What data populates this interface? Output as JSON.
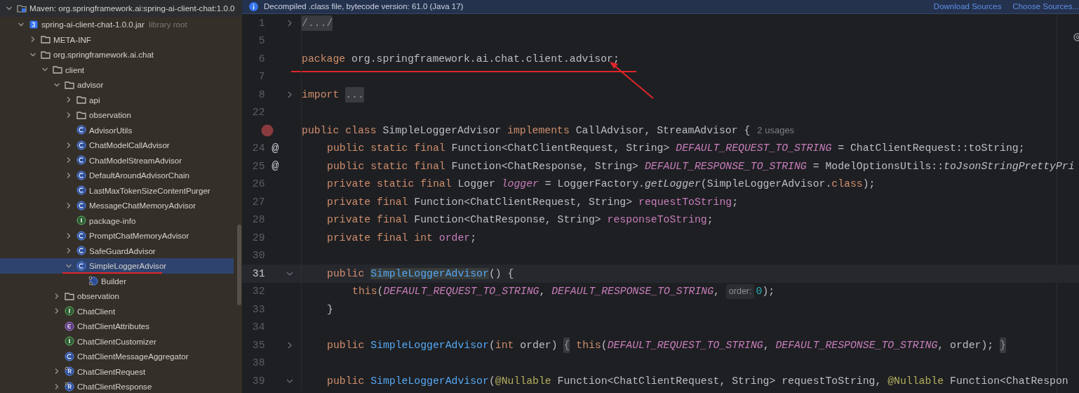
{
  "info_bar": {
    "message": "Decompiled .class file, bytecode version: 61.0 (Java 17)",
    "links": [
      "Download Sources",
      "Choose Sources..."
    ]
  },
  "project_tree": {
    "items": [
      {
        "label": "Maven: org.springframework.ai:spring-ai-client-chat:1.0.0",
        "kind": "library",
        "expanded": true,
        "selected": false,
        "children": [
          {
            "label": "spring-ai-client-chat-1.0.0.jar",
            "hint": "library root",
            "kind": "jar",
            "expanded": true,
            "selected": false,
            "children": [
              {
                "label": "META-INF",
                "kind": "folder",
                "expanded": false,
                "selected": false
              },
              {
                "label": "org.springframework.ai.chat",
                "kind": "folder",
                "expanded": true,
                "selected": false,
                "children": [
                  {
                    "label": "client",
                    "kind": "folder",
                    "expanded": true,
                    "selected": false,
                    "children": [
                      {
                        "label": "advisor",
                        "kind": "folder",
                        "expanded": true,
                        "selected": false,
                        "children": [
                          {
                            "label": "api",
                            "kind": "folder",
                            "expanded": false,
                            "selected": false
                          },
                          {
                            "label": "observation",
                            "kind": "folder",
                            "expanded": false,
                            "selected": false
                          },
                          {
                            "label": "AdvisorUtils",
                            "kind": "class",
                            "selected": false
                          },
                          {
                            "label": "ChatModelCallAdvisor",
                            "kind": "class",
                            "expanded": false,
                            "selected": false
                          },
                          {
                            "label": "ChatModelStreamAdvisor",
                            "kind": "class",
                            "expanded": false,
                            "selected": false
                          },
                          {
                            "label": "DefaultAroundAdvisorChain",
                            "kind": "class",
                            "expanded": false,
                            "selected": false
                          },
                          {
                            "label": "LastMaxTokenSizeContentPurger",
                            "kind": "class",
                            "selected": false
                          },
                          {
                            "label": "MessageChatMemoryAdvisor",
                            "kind": "class",
                            "expanded": false,
                            "selected": false
                          },
                          {
                            "label": "package-info",
                            "kind": "interface",
                            "selected": false
                          },
                          {
                            "label": "PromptChatMemoryAdvisor",
                            "kind": "class",
                            "expanded": false,
                            "selected": false
                          },
                          {
                            "label": "SafeGuardAdvisor",
                            "kind": "class",
                            "expanded": false,
                            "selected": false
                          },
                          {
                            "label": "SimpleLoggerAdvisor",
                            "kind": "class",
                            "expanded": true,
                            "selected": true,
                            "underlined": true,
                            "children": [
                              {
                                "label": "Builder",
                                "kind": "builder",
                                "selected": false
                              }
                            ]
                          }
                        ]
                      },
                      {
                        "label": "observation",
                        "kind": "folder",
                        "expanded": false,
                        "selected": false
                      },
                      {
                        "label": "ChatClient",
                        "kind": "interface",
                        "expanded": false,
                        "selected": false
                      },
                      {
                        "label": "ChatClientAttributes",
                        "kind": "enum",
                        "selected": false
                      },
                      {
                        "label": "ChatClientCustomizer",
                        "kind": "interface",
                        "selected": false
                      },
                      {
                        "label": "ChatClientMessageAggregator",
                        "kind": "class",
                        "selected": false
                      },
                      {
                        "label": "ChatClientRequest",
                        "kind": "record",
                        "expanded": false,
                        "selected": false
                      },
                      {
                        "label": "ChatClientResponse",
                        "kind": "record",
                        "expanded": false,
                        "selected": false
                      }
                    ]
                  }
                ]
              }
            ]
          }
        ]
      }
    ]
  },
  "editor": {
    "lines": [
      {
        "number": "1",
        "fold_expanded": false,
        "tokens": [
          {
            "kind": "folded",
            "text": "/.../"
          }
        ]
      },
      {
        "number": "5"
      },
      {
        "number": "6",
        "underlined": true,
        "arrow": true,
        "tokens": [
          {
            "kind": "kw",
            "text": "package "
          },
          {
            "kind": "plain",
            "text": "org.springframework.ai.chat.client.advisor;"
          }
        ]
      },
      {
        "number": "7"
      },
      {
        "number": "8",
        "fold_expanded": false,
        "tokens": [
          {
            "kind": "kw",
            "text": "import "
          },
          {
            "kind": "folded",
            "text": "..."
          }
        ]
      },
      {
        "number": "22"
      },
      {
        "breakpoint": true,
        "tokens": [
          {
            "kind": "kw",
            "text": "public class "
          },
          {
            "kind": "plain",
            "text": "SimpleLoggerAdvisor "
          },
          {
            "kind": "kw",
            "text": "implements "
          },
          {
            "kind": "plain",
            "text": "CallAdvisor, StreamAdvisor {"
          },
          {
            "kind": "usages",
            "text": "2 usages"
          }
        ],
        "children": [
          {
            "number": "24",
            "marker": "@",
            "tokens": [
              {
                "kind": "kw",
                "text": "public static final "
              },
              {
                "kind": "plain",
                "text": "Function<ChatClientRequest, String> "
              },
              {
                "kind": "const",
                "text": "DEFAULT_REQUEST_TO_STRING"
              },
              {
                "kind": "plain",
                "text": " = ChatClientRequest::toString;"
              }
            ]
          },
          {
            "number": "25",
            "marker": "@",
            "tokens": [
              {
                "kind": "kw",
                "text": "public static final "
              },
              {
                "kind": "plain",
                "text": "Function<ChatResponse, String> "
              },
              {
                "kind": "const",
                "text": "DEFAULT_RESPONSE_TO_STRING"
              },
              {
                "kind": "plain",
                "text": " = ModelOptionsUtils::"
              },
              {
                "kind": "static",
                "text": "toJsonStringPrettyPri"
              }
            ]
          },
          {
            "number": "26",
            "tokens": [
              {
                "kind": "kw",
                "text": "private static final "
              },
              {
                "kind": "plain",
                "text": "Logger "
              },
              {
                "kind": "const",
                "text": "logger"
              },
              {
                "kind": "plain",
                "text": " = LoggerFactory."
              },
              {
                "kind": "static",
                "text": "getLogger"
              },
              {
                "kind": "plain",
                "text": "(SimpleLoggerAdvisor."
              },
              {
                "kind": "kw",
                "text": "class"
              },
              {
                "kind": "plain",
                "text": ");"
              }
            ]
          },
          {
            "number": "27",
            "tokens": [
              {
                "kind": "kw",
                "text": "private final "
              },
              {
                "kind": "plain",
                "text": "Function<ChatClientRequest, String> "
              },
              {
                "kind": "field",
                "text": "requestToString"
              },
              {
                "kind": "plain",
                "text": ";"
              }
            ]
          },
          {
            "number": "28",
            "tokens": [
              {
                "kind": "kw",
                "text": "private final "
              },
              {
                "kind": "plain",
                "text": "Function<ChatResponse, String> "
              },
              {
                "kind": "field",
                "text": "responseToString"
              },
              {
                "kind": "plain",
                "text": ";"
              }
            ]
          },
          {
            "number": "29",
            "tokens": [
              {
                "kind": "kw",
                "text": "private final int "
              },
              {
                "kind": "field",
                "text": "order"
              },
              {
                "kind": "plain",
                "text": ";"
              }
            ]
          },
          {
            "number": "30"
          },
          {
            "number": "31",
            "current": true,
            "fold_expanded": true,
            "tokens": [
              {
                "kind": "kw",
                "text": "public "
              },
              {
                "kind": "decl-mark",
                "text": "SimpleLoggerAdvisor"
              },
              {
                "kind": "plain",
                "text": "() {"
              }
            ],
            "children": [
              {
                "number": "32",
                "tokens": [
                  {
                    "kind": "kw",
                    "text": "this"
                  },
                  {
                    "kind": "plain",
                    "text": "("
                  },
                  {
                    "kind": "const",
                    "text": "DEFAULT_REQUEST_TO_STRING"
                  },
                  {
                    "kind": "plain",
                    "text": ", "
                  },
                  {
                    "kind": "const",
                    "text": "DEFAULT_RESPONSE_TO_STRING"
                  },
                  {
                    "kind": "plain",
                    "text": ", "
                  },
                  {
                    "kind": "hint",
                    "text": "order:"
                  },
                  {
                    "kind": "num",
                    "text": "0"
                  },
                  {
                    "kind": "plain",
                    "text": ");"
                  }
                ]
              }
            ]
          },
          {
            "number": "33",
            "tokens": [
              {
                "kind": "plain",
                "text": "}"
              }
            ]
          },
          {
            "number": "34"
          },
          {
            "number": "35",
            "fold_expanded": false,
            "tokens": [
              {
                "kind": "kw",
                "text": "public "
              },
              {
                "kind": "decl",
                "text": "SimpleLoggerAdvisor"
              },
              {
                "kind": "plain",
                "text": "("
              },
              {
                "kind": "kw",
                "text": "int "
              },
              {
                "kind": "plain",
                "text": "order) "
              },
              {
                "kind": "folded",
                "text": "{"
              },
              {
                "kind": "kw",
                "text": " this"
              },
              {
                "kind": "plain",
                "text": "("
              },
              {
                "kind": "const",
                "text": "DEFAULT_REQUEST_TO_STRING"
              },
              {
                "kind": "plain",
                "text": ", "
              },
              {
                "kind": "const",
                "text": "DEFAULT_RESPONSE_TO_STRING"
              },
              {
                "kind": "plain",
                "text": ", order); "
              },
              {
                "kind": "folded",
                "text": "}"
              }
            ]
          },
          {
            "number": "38"
          },
          {
            "number": "39",
            "fold_expanded": true,
            "tokens": [
              {
                "kind": "kw",
                "text": "public "
              },
              {
                "kind": "decl",
                "text": "SimpleLoggerAdvisor"
              },
              {
                "kind": "plain",
                "text": "("
              },
              {
                "kind": "annot",
                "text": "@Nullable "
              },
              {
                "kind": "plain",
                "text": "Function<ChatClientRequest, String> requestToString, "
              },
              {
                "kind": "annot",
                "text": "@Nullable "
              },
              {
                "kind": "plain",
                "text": "Function<ChatRespon"
              }
            ]
          }
        ]
      }
    ]
  }
}
